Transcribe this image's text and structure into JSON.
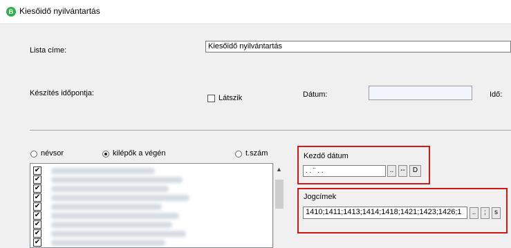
{
  "window": {
    "title": "Kiesőidő nyilvántartás",
    "icon_letter": "B"
  },
  "form": {
    "lista_cime_label": "Lista címe:",
    "lista_cime_value": "Kiesőidő nyilvántartás",
    "keszites_label": "Készítés időpontja:",
    "latszik_label": "Látszik",
    "datum_label": "Dátum:",
    "datum_value": "",
    "ido_label": "Idő:"
  },
  "sort": {
    "options": [
      "névsor",
      "kilépők a végén",
      "t.szám"
    ],
    "selected": "kilépők a végén"
  },
  "kezdo_datum": {
    "label": "Kezdő dátum",
    "value": " .  .  ¨  .  .",
    "btn_dots": "..",
    "btn_dash": "--",
    "btn_d": "D"
  },
  "jogcimek": {
    "label": "Jogcímek",
    "value": "1410;1411;1413;1414;1418;1421;1423;1426;1",
    "btn_dots": "..",
    "btn_semicolon": ";",
    "btn_s": "s"
  },
  "list": {
    "checked_count": 9
  }
}
